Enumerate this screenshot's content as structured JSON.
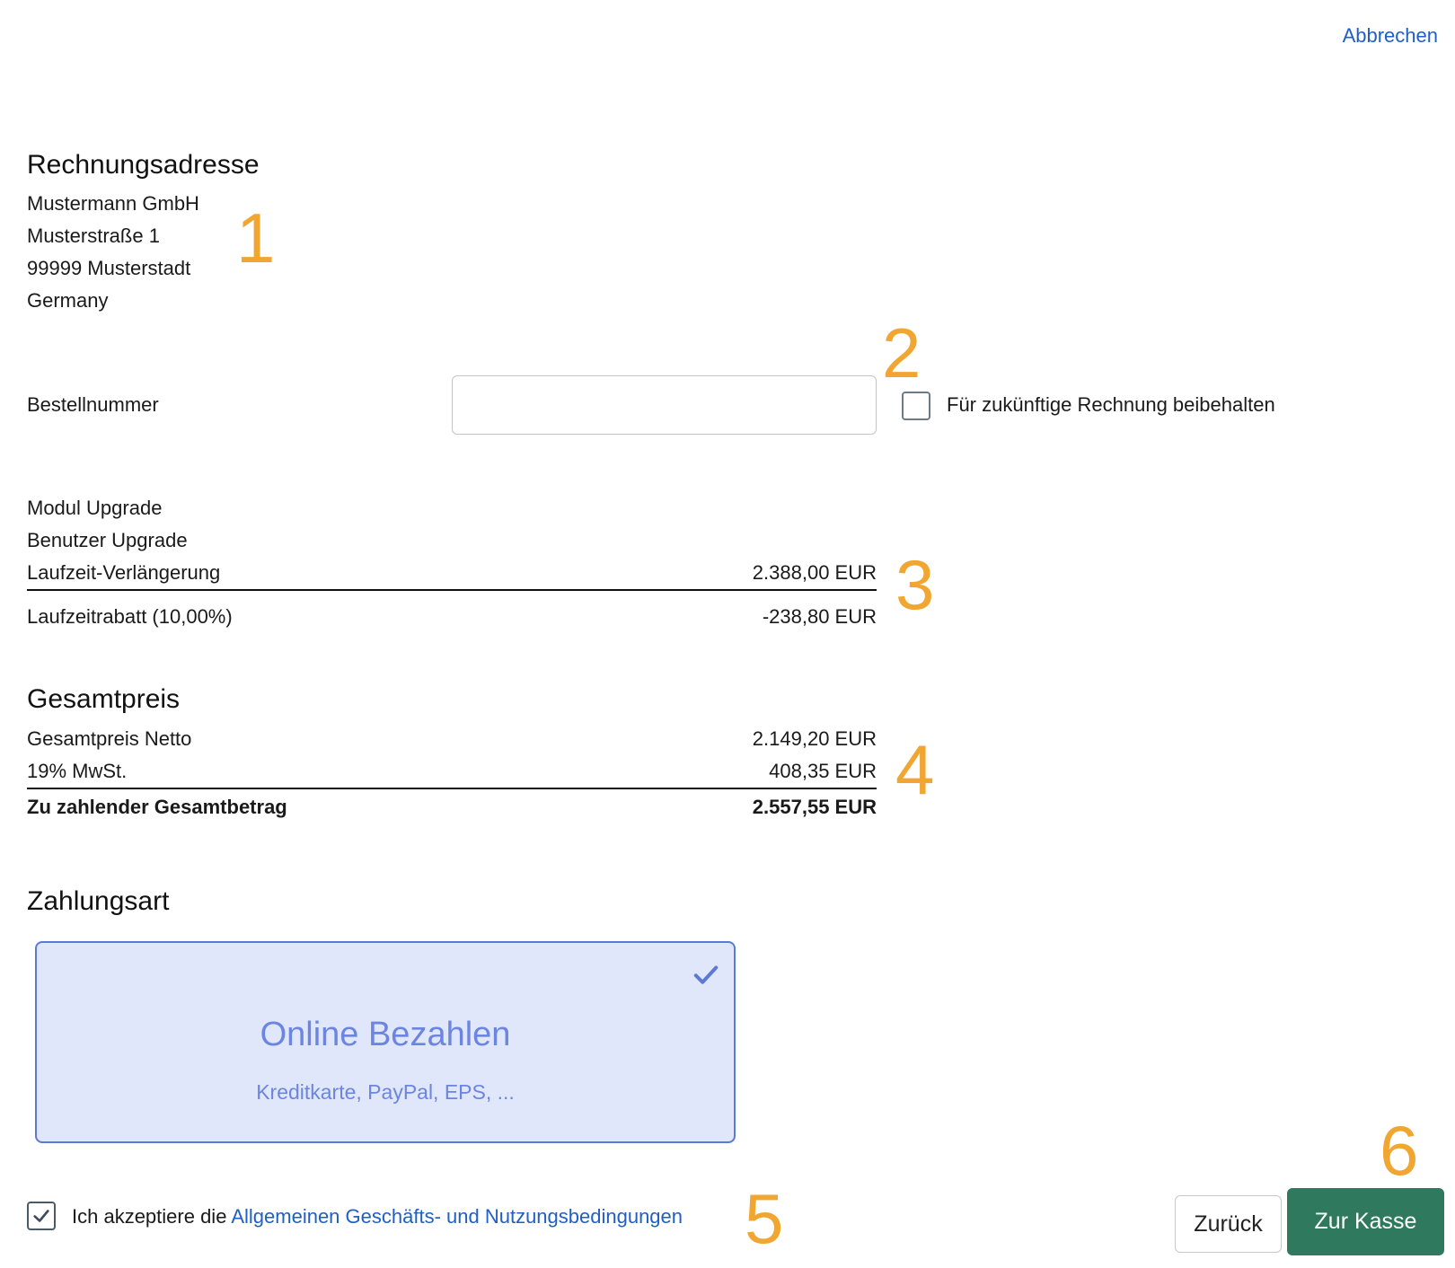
{
  "header": {
    "cancel_label": "Abbrechen"
  },
  "billing": {
    "title": "Rechnungsadresse",
    "lines": [
      "Mustermann GmbH",
      "Musterstraße 1",
      "99999 Musterstadt",
      "Germany"
    ]
  },
  "order_number": {
    "label": "Bestellnummer",
    "value": "",
    "keep_label": "Für zukünftige Rechnung beibehalten",
    "keep_checked": false
  },
  "items": {
    "lines": [
      "Modul Upgrade",
      "Benutzer Upgrade",
      "Laufzeit-Verlängerung"
    ],
    "subtotal": "2.388,00 EUR",
    "discount_label": "Laufzeitrabatt (10,00%)",
    "discount_value": "-238,80 EUR"
  },
  "total": {
    "title": "Gesamtpreis",
    "net_label": "Gesamtpreis Netto",
    "net_value": "2.149,20 EUR",
    "vat_label": "19% MwSt.",
    "vat_value": "408,35 EUR",
    "grand_label": "Zu zahlender Gesamtbetrag",
    "grand_value": "2.557,55 EUR"
  },
  "payment": {
    "title": "Zahlungsart",
    "option_title": "Online Bezahlen",
    "option_subtitle": "Kreditkarte, PayPal, EPS, ...",
    "selected": true
  },
  "terms": {
    "prefix": "Ich akzeptiere die",
    "link": "Allgemeinen Geschäfts- und Nutzungsbedingungen",
    "checked": true
  },
  "footer": {
    "back_label": "Zurück",
    "checkout_label": "Zur Kasse"
  },
  "markers": [
    "1",
    "2",
    "3",
    "4",
    "5",
    "6"
  ],
  "colors": {
    "marker": "#f0a631",
    "link": "#1f5fc7",
    "primary": "#2f7a5e",
    "card_bg": "#e1e7fa",
    "card_border": "#5c79d6"
  }
}
